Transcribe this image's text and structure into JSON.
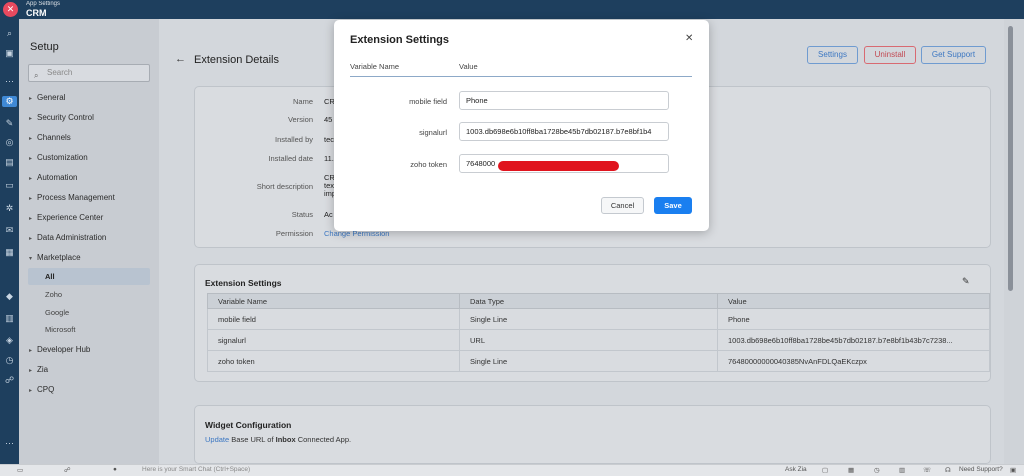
{
  "topbar": {
    "subtitle": "App Settings",
    "app_name": "CRM",
    "logo_icon": "close-circle-icon"
  },
  "sidebar": {
    "title": "Setup",
    "search_placeholder": "Search",
    "items": [
      {
        "label": "General"
      },
      {
        "label": "Security Control"
      },
      {
        "label": "Channels"
      },
      {
        "label": "Customization"
      },
      {
        "label": "Automation"
      },
      {
        "label": "Process Management"
      },
      {
        "label": "Experience Center"
      },
      {
        "label": "Data Administration"
      },
      {
        "label": "Marketplace"
      }
    ],
    "marketplace_sub": [
      {
        "label": "All"
      },
      {
        "label": "Zoho"
      },
      {
        "label": "Google"
      },
      {
        "label": "Microsoft"
      }
    ],
    "items_after": [
      {
        "label": "Developer Hub"
      },
      {
        "label": "Zia"
      },
      {
        "label": "CPQ"
      }
    ]
  },
  "page": {
    "title": "Extension Details",
    "buttons": {
      "settings": "Settings",
      "uninstall": "Uninstall",
      "support": "Get Support"
    },
    "details": [
      {
        "label": "Name",
        "value": "CR"
      },
      {
        "label": "Version",
        "value": "45"
      },
      {
        "label": "Installed by",
        "value": "tec"
      },
      {
        "label": "Installed date",
        "value": "11."
      },
      {
        "label": "Short description",
        "value": "CR\ntex\nimp"
      },
      {
        "label": "Status",
        "value": "Ac"
      },
      {
        "label": "Permission",
        "value": "Change Permission"
      }
    ]
  },
  "ext_settings": {
    "title": "Extension Settings",
    "columns": [
      "Variable Name",
      "Data Type",
      "Value"
    ],
    "rows": [
      [
        "mobile field",
        "Single Line",
        "Phone"
      ],
      [
        "signalurl",
        "URL",
        "1003.db698e6b10ff8ba1728be45b7db02187.b7e8bf1b43b7c7238..."
      ],
      [
        "zoho token",
        "Single Line",
        "76480000000040385NvAnFDLQaEKczpx"
      ]
    ]
  },
  "widget": {
    "title": "Widget Configuration",
    "link": "Update",
    "text_a": "Base URL of",
    "text_bold": "Inbox",
    "text_b": "Connected App."
  },
  "modal": {
    "title": "Extension Settings",
    "col_variable": "Variable Name",
    "col_value": "Value",
    "fields": [
      {
        "label": "mobile field",
        "value": "Phone"
      },
      {
        "label": "signalurl",
        "value": "1003.db698e6b10ff8ba1728be45b7db02187.b7e8bf1b4"
      },
      {
        "label": "zoho token",
        "value": "7648000"
      }
    ],
    "cancel": "Cancel",
    "save": "Save"
  },
  "bottombar": {
    "smart_chat": "Here is your Smart Chat (Ctrl+Space)",
    "ask_zia": "Ask Zia",
    "need_support": "Need Support?"
  },
  "colors": {
    "primary": "#1a7ff0",
    "rail": "#1e3f5e",
    "danger": "#e0141e"
  }
}
